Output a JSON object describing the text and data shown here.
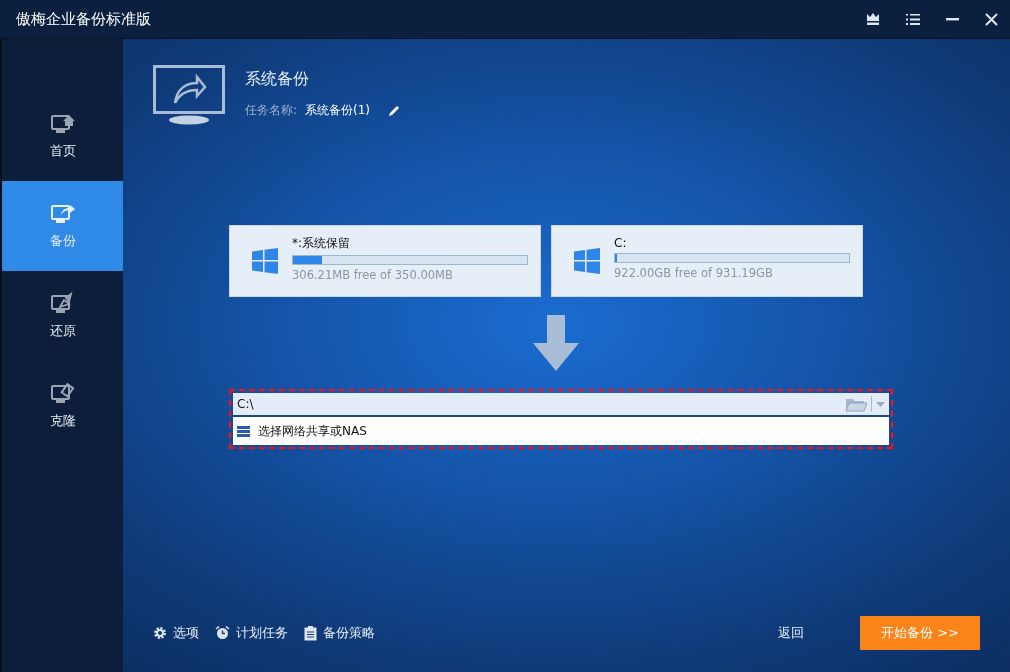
{
  "window": {
    "title": "傲梅企业备份标准版"
  },
  "sidebar": {
    "items": [
      {
        "label": "首页",
        "selected": false,
        "kind": "home"
      },
      {
        "label": "备份",
        "selected": true,
        "kind": "backup"
      },
      {
        "label": "还原",
        "selected": false,
        "kind": "restore"
      },
      {
        "label": "克隆",
        "selected": false,
        "kind": "clone"
      }
    ]
  },
  "task": {
    "title": "系统备份",
    "name_label": "任务名称:",
    "name_value": "系统备份(1)"
  },
  "sources": [
    {
      "name": "*:系统保留",
      "level": 0.125,
      "info": "306.21MB free of 350.00MB"
    },
    {
      "name": "C:",
      "level": 0.01,
      "info": "922.00GB free of 931.19GB"
    }
  ],
  "destination": {
    "path": "C:\\",
    "option": "选择网络共享或NAS"
  },
  "footer": {
    "links": [
      {
        "label": "选项",
        "kind": "gear"
      },
      {
        "label": "计划任务",
        "kind": "clock"
      },
      {
        "label": "备份策略",
        "kind": "clipboard"
      }
    ],
    "back": "返回",
    "start": "开始备份 >>"
  }
}
